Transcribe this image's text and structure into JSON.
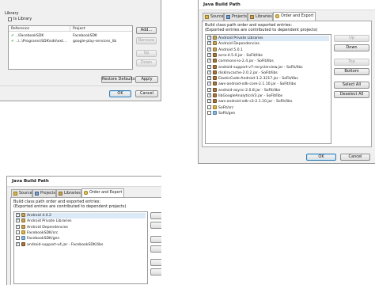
{
  "win1": {
    "library_label": "Library",
    "is_library_label": "Is Library",
    "table": {
      "columns": [
        "Reference",
        "Project"
      ],
      "rows": [
        {
          "reference": "..\\FacebookSDK",
          "project": "FacebookSDK"
        },
        {
          "reference": "..\\..\\Programs\\SDK\\sdk\\ext...",
          "project": "google-play-services_lib"
        }
      ]
    },
    "buttons": {
      "add": "Add...",
      "remove": "Remove",
      "up": "Up",
      "down": "Down"
    },
    "restore_defaults": "Restore Defaults",
    "apply": "Apply",
    "ok": "OK",
    "cancel": "Cancel"
  },
  "win2": {
    "title": "Java Build Path",
    "tabs": [
      "Source",
      "Projects",
      "Libraries",
      "Order and Export"
    ],
    "description": "Build class path order and exported entries:",
    "description2": "(Exported entries are contributed to dependent projects)",
    "entries": [
      {
        "label": "Android Private Libraries",
        "checked": true,
        "icon": "library-icon"
      },
      {
        "label": "Android Dependencies",
        "checked": true,
        "icon": "library-icon"
      },
      {
        "label": "Android 5.0.1",
        "checked": true,
        "icon": "library-icon"
      },
      {
        "label": "acra-4.5.0.jar - SoFit/libs",
        "checked": true,
        "icon": "jar-icon"
      },
      {
        "label": "commons-io-2.4.jar - SoFit/libs",
        "checked": true,
        "icon": "jar-icon"
      },
      {
        "label": "android-support-v7-recyclerview.jar - SoFit/libs",
        "checked": true,
        "icon": "jar-icon"
      },
      {
        "label": "disklrucache-2.0.2.jar - SoFit/libs",
        "checked": true,
        "icon": "jar-icon"
      },
      {
        "label": "ElasticCode-Android-1.2.3217.jar - SoFit/libs",
        "checked": true,
        "icon": "jar-icon"
      },
      {
        "label": "aws-android-sdk-core-2.1.10.jar - SoFit/libs",
        "checked": true,
        "icon": "jar-icon"
      },
      {
        "label": "android-async-2.0.8.jar - SoFit/libs",
        "checked": true,
        "icon": "jar-icon"
      },
      {
        "label": "libGoogleAnalyticsV3.jar - SoFit/libs",
        "checked": true,
        "icon": "jar-icon"
      },
      {
        "label": "aws-android-sdk-s3-2.1.10.jar - SoFit/libs",
        "checked": true,
        "icon": "jar-icon"
      },
      {
        "label": "SoFit/src",
        "checked": false,
        "icon": "source-folder-icon"
      },
      {
        "label": "SoFit/gen",
        "checked": false,
        "icon": "gen-folder-icon"
      }
    ],
    "buttons": {
      "up": "Up",
      "down": "Down",
      "top": "Top",
      "bottom": "Bottom",
      "select_all": "Select All",
      "deselect_all": "Deselect All"
    },
    "ok": "OK",
    "cancel": "Cancel"
  },
  "win3": {
    "title": "Java Build Path",
    "tabs": [
      "Source",
      "Projects",
      "Libraries",
      "Order and Export"
    ],
    "description": "Build class path order and exported entries:",
    "description2": "(Exported entries are contributed to dependent projects)",
    "entries": [
      {
        "label": "Android 4.4.2",
        "checked": true,
        "icon": "library-icon"
      },
      {
        "label": "Android Private Libraries",
        "checked": true,
        "icon": "library-icon"
      },
      {
        "label": "Android Dependencies",
        "checked": true,
        "icon": "library-icon"
      },
      {
        "label": "FacebookSDK/src",
        "checked": false,
        "icon": "source-folder-icon"
      },
      {
        "label": "FacebookSDK/gen",
        "checked": false,
        "icon": "gen-folder-icon"
      },
      {
        "label": "android-support-v4.jar - FacebookSDK/libs",
        "checked": true,
        "icon": "jar-icon"
      }
    ]
  }
}
